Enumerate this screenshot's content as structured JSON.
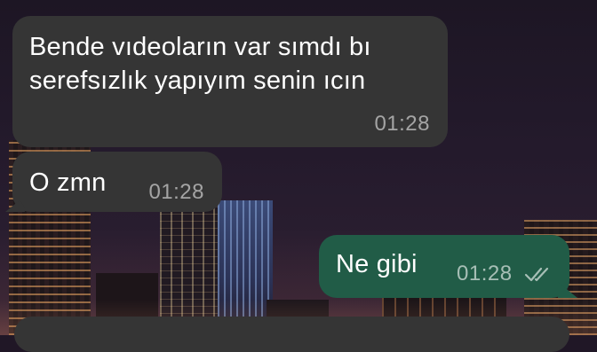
{
  "messages": [
    {
      "direction": "incoming",
      "text": "Bende vıdeoların var sımdı bı\nserefsızlık yapıyım senin ıcın",
      "time": "01:28"
    },
    {
      "direction": "incoming",
      "text": "O zmn",
      "time": "01:28"
    },
    {
      "direction": "outgoing",
      "text": "Ne gibi",
      "time": "01:28",
      "status_icon": "double-check-icon"
    }
  ],
  "colors": {
    "incoming_bubble": "#353535",
    "outgoing_bubble": "#215c47",
    "text": "#ffffff"
  }
}
